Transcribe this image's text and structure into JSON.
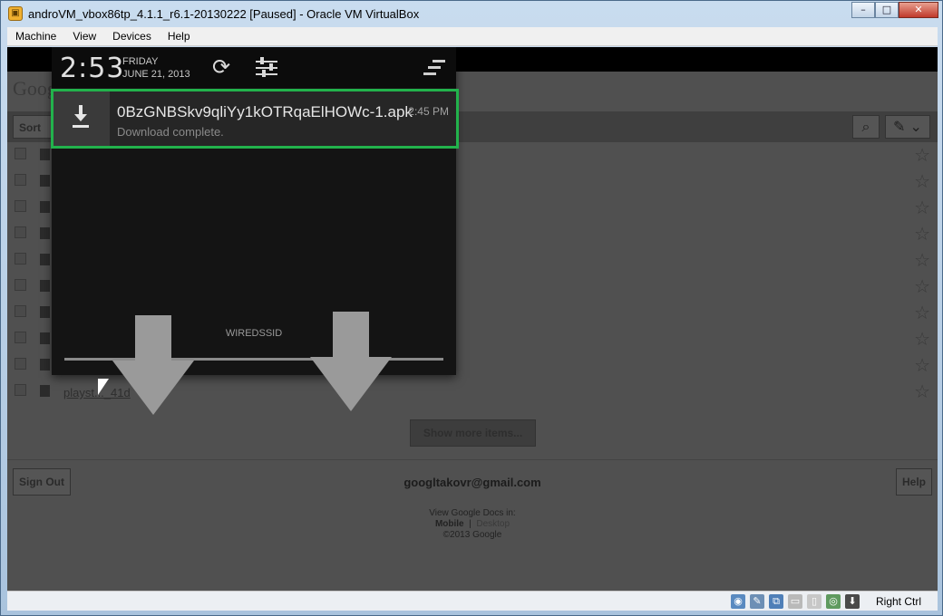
{
  "window": {
    "title": "androVM_vbox86tp_4.1.1_r6.1-20130222 [Paused] - Oracle VM VirtualBox",
    "minimize": "–",
    "maximize": "□",
    "close": "✕"
  },
  "menubar": {
    "items": [
      "Machine",
      "View",
      "Devices",
      "Help"
    ]
  },
  "shade": {
    "time": "2:53",
    "day": "FRIDAY",
    "date": "JUNE 21, 2013",
    "carrier": "WIREDSSID",
    "notification": {
      "title": "0BzGNBSkv9qliYy1kOTRqaElHOWc-1.apk",
      "time": "2:45 PM",
      "subtitle": "Download complete."
    }
  },
  "page": {
    "logo": "Goog",
    "sort_label": "Sort",
    "files": [
      "",
      "",
      "",
      "",
      "",
      "",
      "",
      "",
      "",
      "playst..._41d"
    ],
    "show_more": "Show more items...",
    "sign_out": "Sign Out",
    "help": "Help",
    "email": "googltakovr@gmail.com",
    "view_in": "View Google Docs in:",
    "mobile": "Mobile",
    "separator": "|",
    "desktop": "Desktop",
    "copyright": "©2013 Google"
  },
  "statusbar": {
    "host_key": "Right Ctrl"
  },
  "colors": {
    "highlight": "#22b24c"
  }
}
